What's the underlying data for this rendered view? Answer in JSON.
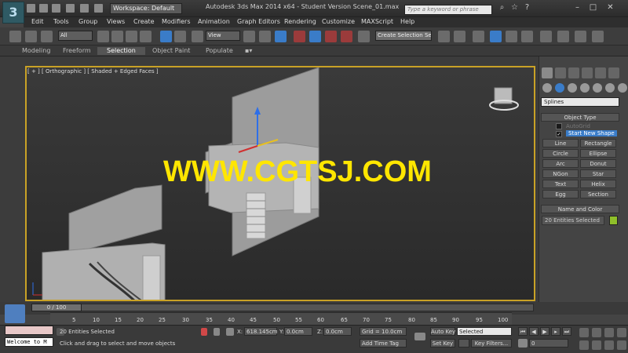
{
  "titlebar": {
    "workspace": "Workspace: Default",
    "title": "Autodesk 3ds Max 2014 x64 - Student Version    Scene_01.max",
    "search_placeholder": "Type a keyword or phrase",
    "app_logo": "3"
  },
  "menu": [
    "Edit",
    "Tools",
    "Group",
    "Views",
    "Create",
    "Modifiers",
    "Animation",
    "Graph Editors",
    "Rendering",
    "Customize",
    "MAXScript",
    "Help"
  ],
  "toolbar": {
    "filter_value": "All",
    "coord_value": "View",
    "selection_set_placeholder": "Create Selection Se"
  },
  "ribbon": {
    "tabs": [
      "Modeling",
      "Freeform",
      "Selection",
      "Object Paint",
      "Populate"
    ],
    "active": "Selection"
  },
  "viewport": {
    "label": "[ + ] [ Orthographic ] [ Shaded + Edged Faces ]",
    "watermark": "WWW.CGTSJ.COM"
  },
  "command_panel": {
    "dropdown": "Splines",
    "object_type_title": "Object Type",
    "autogrid": "AutoGrid",
    "start_new_shape": "Start New Shape",
    "buttons": [
      "Line",
      "Rectangle",
      "Circle",
      "Ellipse",
      "Arc",
      "Donut",
      "NGon",
      "Star",
      "Text",
      "Helix",
      "Egg",
      "Section"
    ],
    "name_color_title": "Name and Color",
    "name_value": "20 Entities Selected",
    "swatch_color": "#8fbf2a"
  },
  "timeline": {
    "slider_label": "0 / 100",
    "ticks": [
      "5",
      "10",
      "15",
      "20",
      "25",
      "30",
      "35",
      "40",
      "45",
      "50",
      "55",
      "60",
      "65",
      "70",
      "75",
      "80",
      "85",
      "90",
      "95",
      "100"
    ]
  },
  "status": {
    "maxscript_text": "Welcome to M",
    "selected": "20 Entities Selected",
    "prompt": "Click and drag to select and move objects",
    "x_label": "X:",
    "x_value": "618.145cm",
    "y_label": "Y:",
    "y_value": "0.0cm",
    "z_label": "Z:",
    "z_value": "0.0cm",
    "grid": "Grid = 10.0cm",
    "add_time_tag": "Add Time Tag",
    "auto_key": "Auto Key",
    "selected_dropdown": "Selected",
    "set_key": "Set Key",
    "key_filters": "Key Filters...",
    "frame_value": "0"
  },
  "colors": {
    "viewport_border": "#c9a226",
    "watermark": "#ffe600",
    "active_tool": "#3a7cc8"
  }
}
